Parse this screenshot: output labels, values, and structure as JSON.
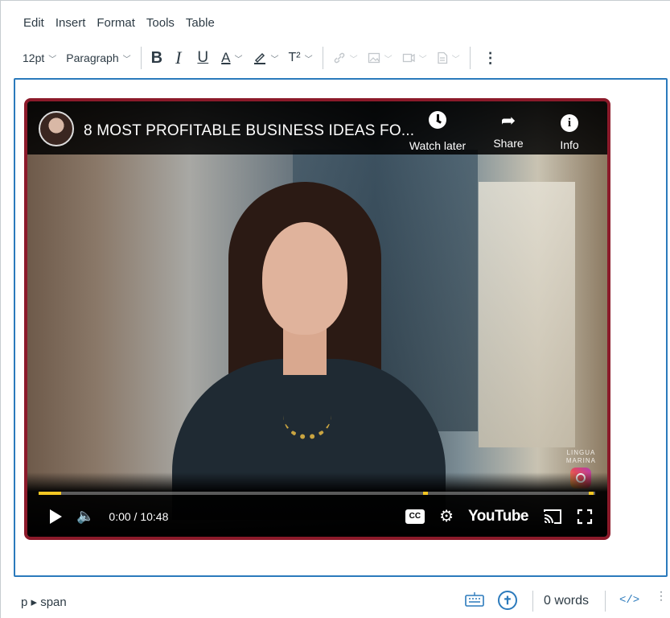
{
  "menubar": {
    "items": [
      "Edit",
      "Insert",
      "Format",
      "Tools",
      "Table"
    ]
  },
  "toolbar": {
    "font_size": "12pt",
    "block_format": "Paragraph",
    "bold": "B",
    "italic": "I",
    "underline": "U",
    "text_color": "A",
    "superscript": "T²",
    "more": "⋮",
    "icons": [
      "bold-icon",
      "italic-icon",
      "underline-icon",
      "text-color-icon",
      "highlight-icon",
      "superscript-icon",
      "link-icon",
      "image-icon",
      "media-icon",
      "document-icon",
      "more-icon"
    ]
  },
  "video": {
    "title": "8 MOST PROFITABLE BUSINESS IDEAS FO...",
    "actions": [
      {
        "label": "Watch later",
        "icon": "clock-icon"
      },
      {
        "label": "Share",
        "icon": "share-icon"
      },
      {
        "label": "Info",
        "icon": "info-icon"
      }
    ],
    "time": "0:00 / 10:48",
    "brand": "YouTube",
    "watermark_line1": "LINGUA",
    "watermark_line2": "MARINA",
    "border_color": "#8b1a2a"
  },
  "statusbar": {
    "path": "p ▸ span",
    "word_count": "0 words",
    "html_toggle": "</>"
  },
  "colors": {
    "accent": "#2b7abc",
    "text": "#2d3b45"
  }
}
